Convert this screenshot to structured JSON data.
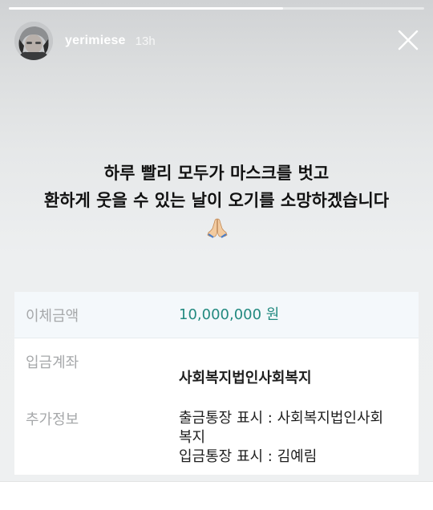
{
  "story": {
    "progress": 0.66,
    "username": "yerimiese",
    "time_ago": "13h",
    "caption_line1": "하루 빨리 모두가 마스크를 벗고",
    "caption_line2": "환하게 웃을 수 있는 날이 오기를 소망하겠습니다",
    "caption_emoji": "folded-hands-icon"
  },
  "receipt": {
    "amount_label": "이체금액",
    "amount_value": "10,000,000 원",
    "account_label": "입금계좌",
    "account_value": "사회복지법인사회복지",
    "extra_label": "추가정보",
    "extra_line1": "출금통장 표시 : 사회복지법인사회",
    "extra_line2": "복지",
    "extra_line3": "입금통장 표시 : 김예림"
  },
  "colors": {
    "amount": "#238a80",
    "label": "#a6a8aa"
  }
}
